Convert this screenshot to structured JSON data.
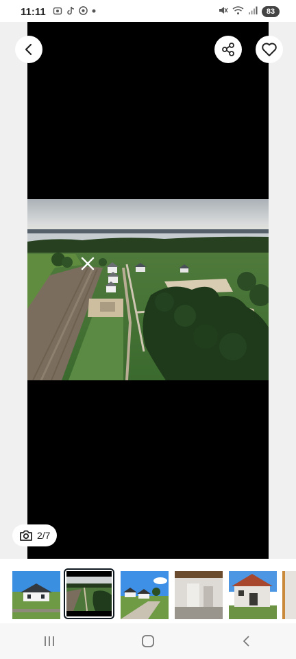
{
  "status_bar": {
    "time": "11:11",
    "battery": "83",
    "icons": [
      "screenshot-icon",
      "tiktok-icon",
      "chrome-icon",
      "dot-icon",
      "mute-icon",
      "wifi-icon",
      "signal-icon"
    ]
  },
  "gallery": {
    "counter": "2/7",
    "back_icon": "back-arrow-icon",
    "share_icon": "share-icon",
    "favorite_icon": "heart-icon",
    "camera_icon": "camera-icon",
    "current_photo_index": 2,
    "total_photos": 7
  },
  "thumbnails": [
    {
      "name": "thumbnail-1-house-exterior"
    },
    {
      "name": "thumbnail-2-aerial-view",
      "selected": true
    },
    {
      "name": "thumbnail-3-houses-road"
    },
    {
      "name": "thumbnail-4-interior"
    },
    {
      "name": "thumbnail-5-house-construction"
    }
  ],
  "navigation_bar": {
    "icons": [
      "recent-apps-icon",
      "home-icon",
      "back-icon"
    ]
  },
  "colors": {
    "accent_dark": "#101820",
    "frame_black": "#000000",
    "pill_white": "#ffffff"
  }
}
